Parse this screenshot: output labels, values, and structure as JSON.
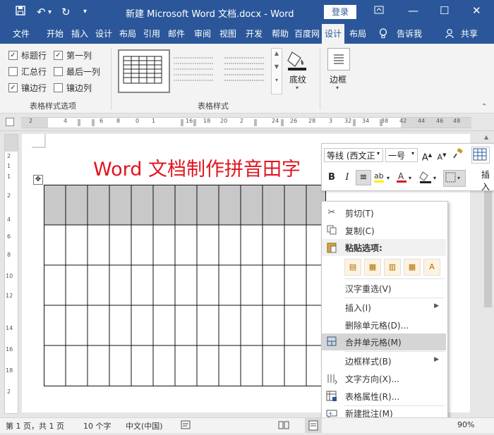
{
  "window": {
    "title": "新建 Microsoft Word 文档.docx  -  Word",
    "login_label": "登录",
    "icons": {
      "save": "save-icon",
      "undo": "undo-icon",
      "redo": "redo-icon",
      "customize": "customize-quick-access-icon",
      "ribbon_display": "ribbon-display-options-icon",
      "minimize": "minimize-icon",
      "maximize": "maximize-icon",
      "close": "close-icon"
    }
  },
  "tabs": [
    {
      "label": "文件"
    },
    {
      "label": "开始"
    },
    {
      "label": "插入"
    },
    {
      "label": "设计"
    },
    {
      "label": "布局"
    },
    {
      "label": "引用"
    },
    {
      "label": "邮件"
    },
    {
      "label": "审阅"
    },
    {
      "label": "视图"
    },
    {
      "label": "开发"
    },
    {
      "label": "帮助"
    },
    {
      "label": "百度网"
    },
    {
      "label": "设计"
    },
    {
      "label": "布局"
    }
  ],
  "tell_me": "告诉我",
  "share": "共享",
  "ribbon": {
    "options": [
      {
        "label": "标题行",
        "checked": true
      },
      {
        "label": "第一列",
        "checked": true
      },
      {
        "label": "汇总行",
        "checked": false
      },
      {
        "label": "最后一列",
        "checked": false
      },
      {
        "label": "镶边行",
        "checked": true
      },
      {
        "label": "镶边列",
        "checked": false
      }
    ],
    "options_group_label": "表格样式选项",
    "styles_group_label": "表格样式",
    "shading_label": "底纹",
    "borders_label": "边框"
  },
  "ruler": {
    "h_numbers": [
      "2",
      "4",
      "6",
      "8",
      "0",
      "1",
      "16",
      "18",
      "20",
      "2",
      "24",
      "26",
      "28",
      "3",
      "32",
      "34",
      "36",
      "38",
      "42",
      "44",
      "46",
      "48"
    ],
    "v_numbers": [
      "2",
      "1",
      "1",
      "2",
      "4",
      "6",
      "8",
      "10",
      "12",
      "14",
      "16",
      "18",
      "2"
    ]
  },
  "document": {
    "title": "Word 文档制作拼音田字"
  },
  "mini_toolbar": {
    "font": "等线 (西文正",
    "size": "一号",
    "bold": "B",
    "italic": "I",
    "insert_label": "插入"
  },
  "context_menu": {
    "items": [
      {
        "label": "剪切(T)",
        "icon": "scissors-icon"
      },
      {
        "label": "复制(C)",
        "icon": "copy-icon"
      },
      {
        "label": "粘贴选项:",
        "icon": "paste-icon"
      },
      {
        "label": "汉字重选(V)",
        "icon": ""
      },
      {
        "label": "插入(I)",
        "icon": ""
      },
      {
        "label": "删除单元格(D)...",
        "icon": ""
      },
      {
        "label": "合并单元格(M)",
        "icon": "merge-cells-icon"
      },
      {
        "label": "边框样式(B)",
        "icon": ""
      },
      {
        "label": "文字方向(X)...",
        "icon": "text-direction-icon"
      },
      {
        "label": "表格属性(R)...",
        "icon": "table-properties-icon"
      },
      {
        "label": "新建批注(M)",
        "icon": "new-comment-icon"
      }
    ]
  },
  "status": {
    "page": "第 1 页，共 1 页",
    "words": "10 个字",
    "language": "中文(中国)",
    "zoom": "90%"
  },
  "table": {
    "rows": 5,
    "cols": 13
  }
}
